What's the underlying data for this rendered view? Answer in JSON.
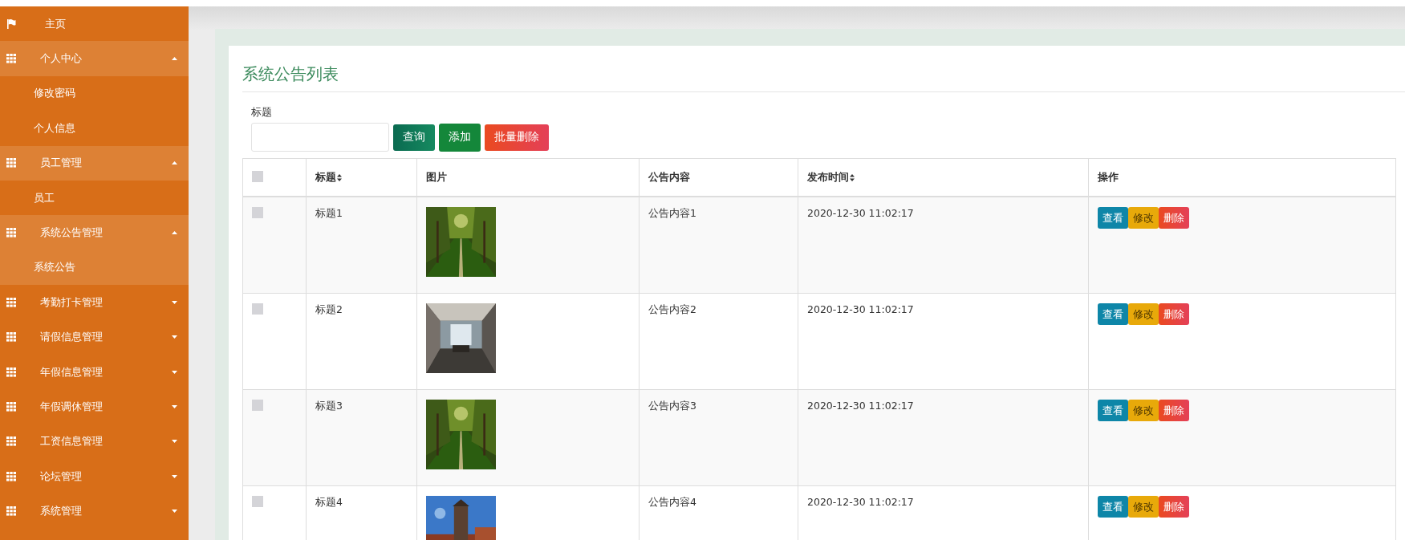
{
  "sidebar": {
    "items": [
      {
        "kind": "home",
        "label": "主页",
        "expanded": false
      },
      {
        "kind": "group",
        "label": "个人中心",
        "expanded": true,
        "children": [
          {
            "label": "修改密码",
            "selected": false
          },
          {
            "label": "个人信息",
            "selected": false
          }
        ]
      },
      {
        "kind": "group",
        "label": "员工管理",
        "expanded": true,
        "children": [
          {
            "label": "员工",
            "selected": false
          }
        ]
      },
      {
        "kind": "group",
        "label": "系统公告管理",
        "expanded": true,
        "children": [
          {
            "label": "系统公告",
            "selected": true
          }
        ]
      },
      {
        "kind": "group",
        "label": "考勤打卡管理",
        "expanded": false
      },
      {
        "kind": "group",
        "label": "请假信息管理",
        "expanded": false
      },
      {
        "kind": "group",
        "label": "年假信息管理",
        "expanded": false
      },
      {
        "kind": "group",
        "label": "年假调休管理",
        "expanded": false
      },
      {
        "kind": "group",
        "label": "工资信息管理",
        "expanded": false
      },
      {
        "kind": "group",
        "label": "论坛管理",
        "expanded": false
      },
      {
        "kind": "group",
        "label": "系统管理",
        "expanded": false
      }
    ]
  },
  "page_title": "系统公告列表",
  "search": {
    "label": "标题",
    "buttons": [
      {
        "kind": "query",
        "label": "查询"
      },
      {
        "kind": "add",
        "label": "添加"
      },
      {
        "kind": "delete",
        "label": "批量删除"
      }
    ]
  },
  "table": {
    "select_all_checked": false,
    "columns": [
      {
        "label": "标题",
        "sortable": true
      },
      {
        "label": "图片",
        "sortable": false
      },
      {
        "label": "公告内容",
        "sortable": false
      },
      {
        "label": "发布时间",
        "sortable": true
      },
      {
        "label": "操作",
        "sortable": false
      }
    ],
    "rows": [
      {
        "checked": false,
        "title": "标题1",
        "image": {
          "kind": "picture"
        },
        "content": "公告内容1",
        "time": "2020-12-30 11:02:17",
        "actions": [
          {
            "kind": "view",
            "label": "查看"
          },
          {
            "kind": "edit",
            "label": "修改"
          },
          {
            "kind": "delete",
            "label": "删除"
          }
        ]
      },
      {
        "checked": false,
        "title": "标题2",
        "image": {
          "kind": "picture"
        },
        "content": "公告内容2",
        "time": "2020-12-30 11:02:17",
        "actions": [
          {
            "kind": "view",
            "label": "查看"
          },
          {
            "kind": "edit",
            "label": "修改"
          },
          {
            "kind": "delete",
            "label": "删除"
          }
        ]
      },
      {
        "checked": false,
        "title": "标题3",
        "image": {
          "kind": "picture"
        },
        "content": "公告内容3",
        "time": "2020-12-30 11:02:17",
        "actions": [
          {
            "kind": "view",
            "label": "查看"
          },
          {
            "kind": "edit",
            "label": "修改"
          },
          {
            "kind": "delete",
            "label": "删除"
          }
        ]
      },
      {
        "checked": false,
        "title": "标题4",
        "image": {
          "kind": "picture"
        },
        "content": "公告内容4",
        "time": "2020-12-30 11:02:17",
        "actions": [
          {
            "kind": "view",
            "label": "查看"
          },
          {
            "kind": "edit",
            "label": "修改"
          },
          {
            "kind": "delete",
            "label": "删除"
          }
        ]
      }
    ]
  }
}
